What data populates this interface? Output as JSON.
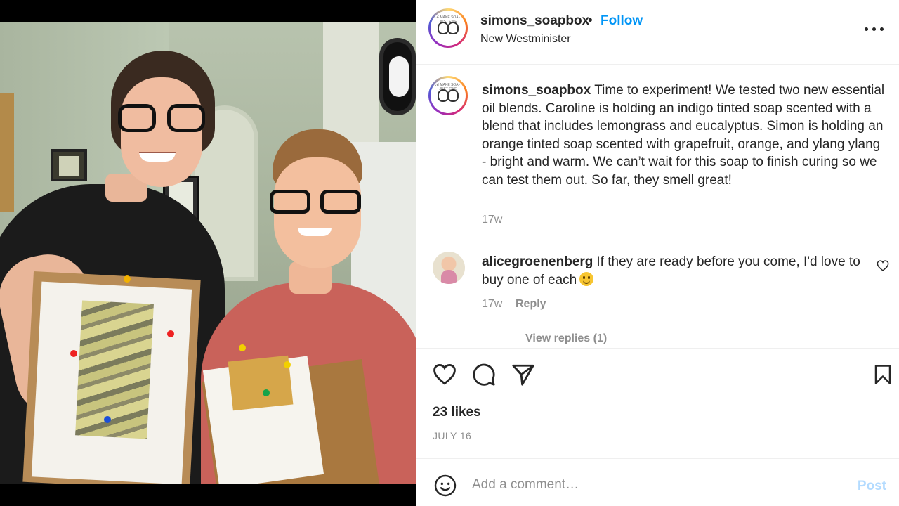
{
  "post": {
    "username": "simons_soapbox",
    "separator": "•",
    "follow_label": "Follow",
    "location": "New Westminister",
    "avatar_text": "WE MAKE SOAP · JUST EWE",
    "caption": "Time to experiment! We tested two new essential oil blends. Caroline is holding an indigo tinted soap scented with a blend that includes lemongrass and eucalyptus. Simon is holding an orange tinted soap scented with grapefruit, orange, and ylang ylang - bright and warm. We can’t wait for this soap to finish curing so we can test them out. So far, they smell great!",
    "caption_time": "17w"
  },
  "comment": {
    "username": "alicegroenenberg",
    "text": "If they are ready before you come, I'd love to buy one of each",
    "time": "17w",
    "reply_label": "Reply",
    "view_replies_label": "View replies (1)"
  },
  "footer": {
    "likes": "23 likes",
    "date": "JULY 16",
    "comment_placeholder": "Add a comment…",
    "post_label": "Post"
  },
  "icons": {
    "like": "heart-icon",
    "comment": "speech-bubble-icon",
    "share": "paper-plane-icon",
    "save": "bookmark-icon",
    "more": "more-horizontal-icon",
    "emoji": "smiley-icon"
  },
  "colors": {
    "accent": "#0095f6",
    "post_disabled": "#b3dbff",
    "muted": "#8e8e8e",
    "text": "#262626"
  }
}
